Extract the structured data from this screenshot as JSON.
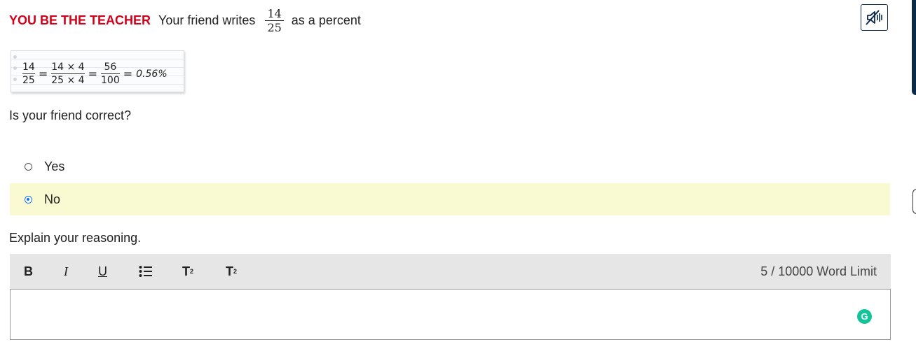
{
  "header": {
    "label": "YOU BE THE TEACHER",
    "prefix": "Your friend writes",
    "fraction": {
      "numerator": "14",
      "denominator": "25"
    },
    "suffix": "as a percent"
  },
  "mute_button": {
    "icon": "speaker-mute-icon"
  },
  "work_image": {
    "frac1": {
      "num": "14",
      "den": "25"
    },
    "frac2": {
      "num": "14 × 4",
      "den": "25 × 4"
    },
    "frac3": {
      "num": "56",
      "den": "100"
    },
    "eq": "=",
    "result": "0.56%"
  },
  "question": "Is your friend correct?",
  "options": [
    {
      "label": "Yes",
      "selected": false
    },
    {
      "label": "No",
      "selected": true
    }
  ],
  "explain_prompt": "Explain your reasoning.",
  "toolbar": {
    "bold": "B",
    "italic": "I",
    "underline": "U",
    "superscript": "T",
    "subscript": "T",
    "word_count": "5",
    "word_limit": "/ 10000 Word Limit"
  },
  "editor": {
    "value": ""
  },
  "colors": {
    "accent": "#d0021b",
    "navy": "#0b2a4a",
    "selected_bg": "#fafad2",
    "radio": "#1a73e8",
    "grammarly": "#15c39a"
  }
}
